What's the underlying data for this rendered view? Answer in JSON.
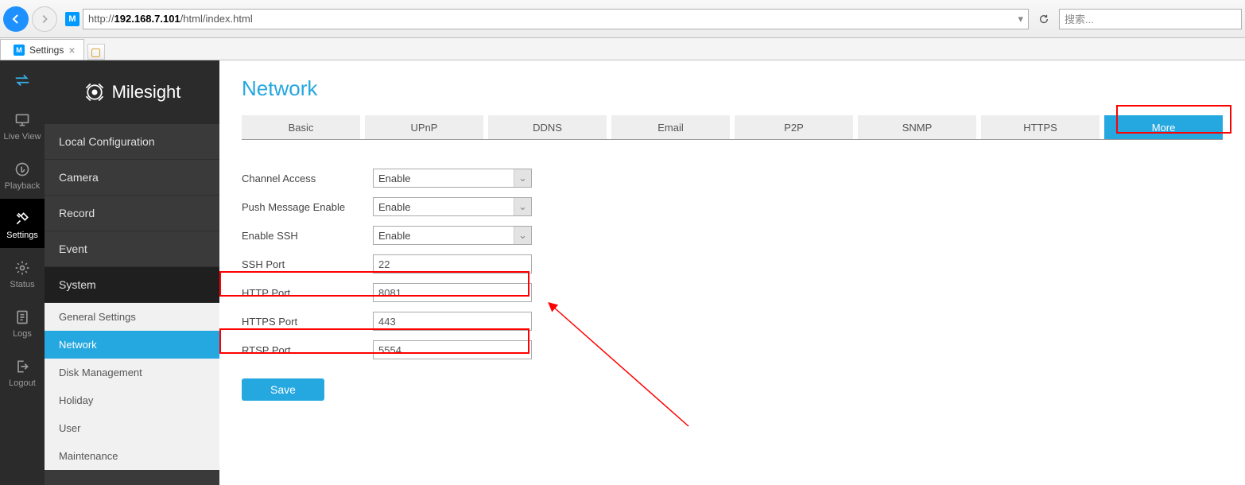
{
  "browser": {
    "url_host": "192.168.7.101",
    "url_pre": "http://",
    "url_path": "/html/index.html",
    "tab_title": "Settings",
    "search_placeholder": "搜索..."
  },
  "rail": {
    "items": [
      {
        "label": ""
      },
      {
        "label": "Live View"
      },
      {
        "label": "Playback"
      },
      {
        "label": "Settings"
      },
      {
        "label": "Status"
      },
      {
        "label": "Logs"
      },
      {
        "label": "Logout"
      }
    ]
  },
  "brand": "Milesight",
  "menu": {
    "items": [
      "Local Configuration",
      "Camera",
      "Record",
      "Event",
      "System"
    ],
    "sub": [
      "General Settings",
      "Network",
      "Disk Management",
      "Holiday",
      "User",
      "Maintenance"
    ]
  },
  "page": {
    "title": "Network",
    "tabs": [
      "Basic",
      "UPnP",
      "DDNS",
      "Email",
      "P2P",
      "SNMP",
      "HTTPS",
      "More"
    ],
    "form": {
      "channel_access": {
        "label": "Channel Access",
        "value": "Enable"
      },
      "push_message": {
        "label": "Push Message Enable",
        "value": "Enable"
      },
      "enable_ssh": {
        "label": "Enable SSH",
        "value": "Enable"
      },
      "ssh_port": {
        "label": "SSH Port",
        "value": "22"
      },
      "http_port": {
        "label": "HTTP Port",
        "value": "8081"
      },
      "https_port": {
        "label": "HTTPS Port",
        "value": "443"
      },
      "rtsp_port": {
        "label": "RTSP Port",
        "value": "5554"
      }
    },
    "save": "Save"
  }
}
